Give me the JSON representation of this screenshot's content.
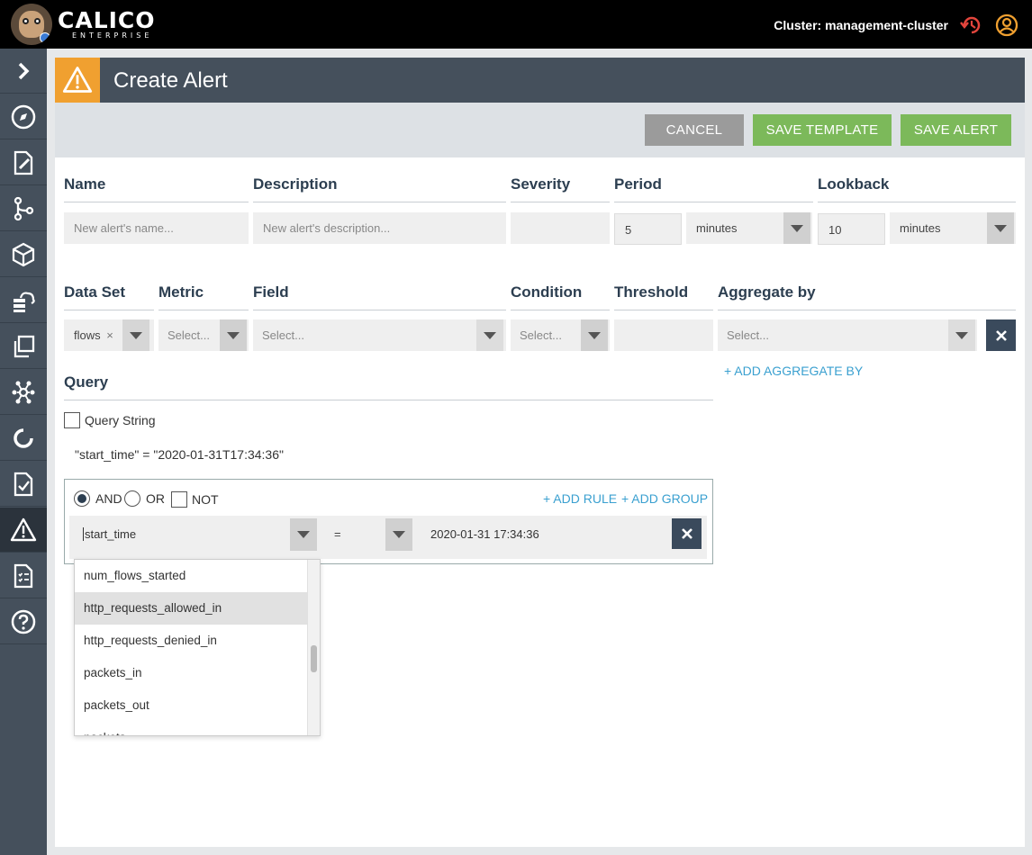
{
  "app": {
    "logo": "CALICO",
    "logo_sub": "ENTERPRISE",
    "cluster_label": "Cluster: management-cluster"
  },
  "sidebar": {
    "items": [
      {
        "icon": "chevron-right-icon"
      },
      {
        "icon": "compass-icon"
      },
      {
        "icon": "policy-edit-icon"
      },
      {
        "icon": "git-branch-icon"
      },
      {
        "icon": "cube-icon"
      },
      {
        "icon": "cloud-server-icon"
      },
      {
        "icon": "copy-icon"
      },
      {
        "icon": "network-graph-icon"
      },
      {
        "icon": "refresh-circle-icon"
      },
      {
        "icon": "compliance-check-icon"
      },
      {
        "icon": "alert-triangle-icon",
        "active": true
      },
      {
        "icon": "checklist-icon"
      },
      {
        "icon": "help-icon"
      }
    ]
  },
  "header": {
    "title": "Create Alert"
  },
  "toolbar": {
    "cancel": "CANCEL",
    "save_template": "SAVE TEMPLATE",
    "save_alert": "SAVE ALERT"
  },
  "form": {
    "name_label": "Name",
    "name_placeholder": "New alert's name...",
    "description_label": "Description",
    "description_placeholder": "New alert's description...",
    "severity_label": "Severity",
    "period_label": "Period",
    "period_value": "5",
    "period_unit": "minutes",
    "lookback_label": "Lookback",
    "lookback_value": "10",
    "lookback_unit": "minutes",
    "dataset_label": "Data Set",
    "dataset_value": "flows",
    "metric_label": "Metric",
    "metric_placeholder": "Select...",
    "field_label": "Field",
    "field_placeholder": "Select...",
    "condition_label": "Condition",
    "condition_placeholder": "Select...",
    "threshold_label": "Threshold",
    "aggregate_label": "Aggregate by",
    "aggregate_placeholder": "Select...",
    "add_aggregate": "+ ADD AGGREGATE BY"
  },
  "query": {
    "label": "Query",
    "query_string_label": "Query String",
    "query_text": "\"start_time\" = \"2020-01-31T17:34:36\"",
    "and_label": "AND",
    "or_label": "OR",
    "not_label": "NOT",
    "add_rule": "+ ADD RULE",
    "add_group": "+ ADD GROUP",
    "rule": {
      "field": "start_time",
      "operator": "=",
      "value": "2020-01-31 17:34:36"
    }
  },
  "dropdown_items": [
    "num_flows_started",
    "http_requests_allowed_in",
    "http_requests_denied_in",
    "packets_in",
    "packets_out",
    "packets..."
  ],
  "colors": {
    "accent_orange": "#f0a030",
    "save_green": "#7cb95a",
    "cancel_gray": "#9b9b9b",
    "link_blue": "#3aa0d0",
    "nav_slate": "#45505c"
  }
}
